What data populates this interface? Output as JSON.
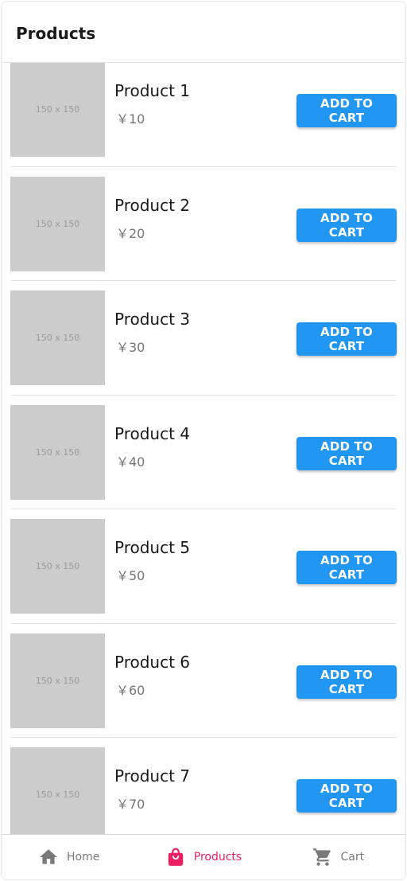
{
  "header": {
    "title": "Products"
  },
  "products": [
    {
      "placeholder": "150 x 150",
      "name": "Product 1",
      "price": "￥10",
      "button": "ADD TO CART"
    },
    {
      "placeholder": "150 x 150",
      "name": "Product 2",
      "price": "￥20",
      "button": "ADD TO CART"
    },
    {
      "placeholder": "150 x 150",
      "name": "Product 3",
      "price": "￥30",
      "button": "ADD TO CART"
    },
    {
      "placeholder": "150 x 150",
      "name": "Product 4",
      "price": "￥40",
      "button": "ADD TO CART"
    },
    {
      "placeholder": "150 x 150",
      "name": "Product 5",
      "price": "￥50",
      "button": "ADD TO CART"
    },
    {
      "placeholder": "150 x 150",
      "name": "Product 6",
      "price": "￥60",
      "button": "ADD TO CART"
    },
    {
      "placeholder": "150 x 150",
      "name": "Product 7",
      "price": "￥70",
      "button": "ADD TO CART"
    }
  ],
  "tabbar": {
    "tabs": [
      {
        "label": "Home",
        "icon": "home-icon",
        "active": false
      },
      {
        "label": "Products",
        "icon": "shopping-bag-icon",
        "active": true
      },
      {
        "label": "Cart",
        "icon": "cart-icon",
        "active": false
      }
    ]
  },
  "colors": {
    "accent": "#2196f3",
    "active_tab": "#e91e63",
    "inactive_tab": "#7a7a7a",
    "thumb": "#cccccc"
  }
}
